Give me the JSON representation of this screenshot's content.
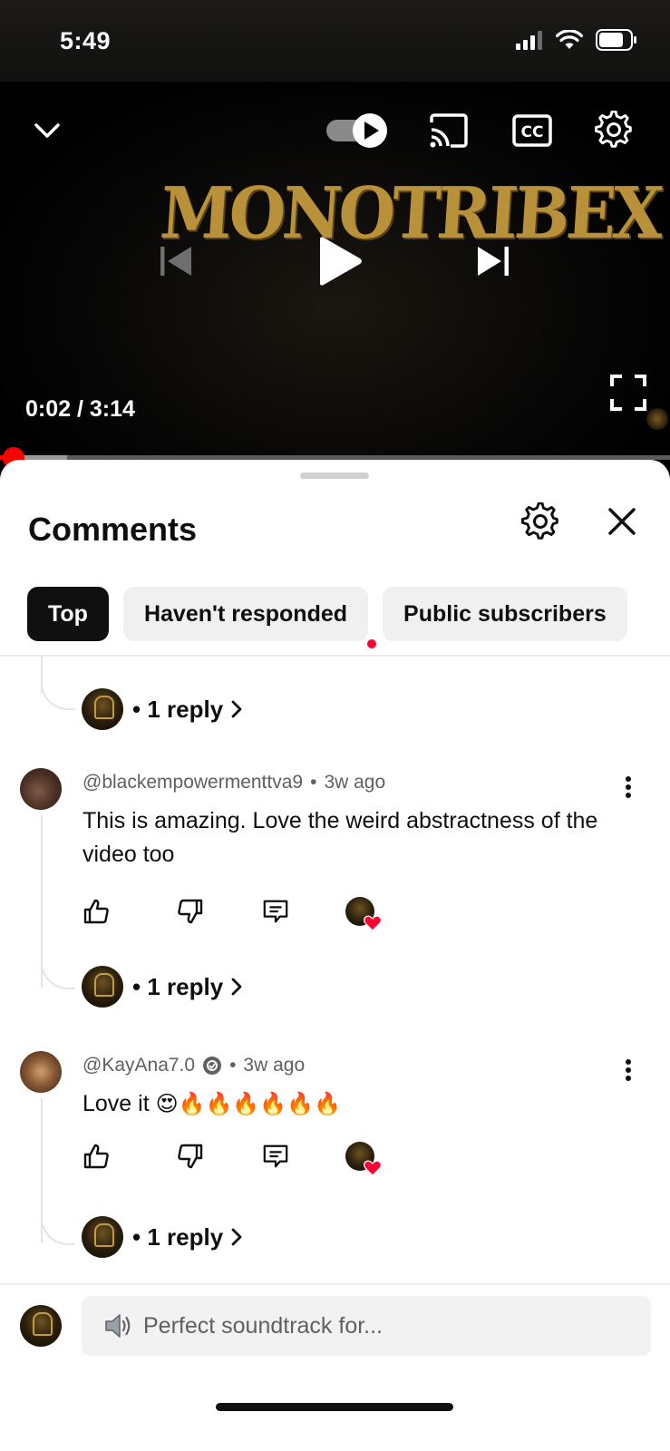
{
  "status_bar": {
    "time": "5:49"
  },
  "player": {
    "video_title_art": "MONOTRIBEX",
    "time": "0:02 / 3:14",
    "progress_fraction": 0.006,
    "buffer_fraction": 0.1,
    "autoplay": true
  },
  "comments_sheet": {
    "title": "Comments",
    "chips": [
      {
        "label": "Top",
        "active": true
      },
      {
        "label": "Haven't responded",
        "active": false
      },
      {
        "label": "Public subscribers",
        "active": false
      }
    ],
    "first_reply": {
      "label": "• 1 reply"
    },
    "comments": [
      {
        "author": "@blackempowermenttva9",
        "time": "3w ago",
        "text": "This is amazing. Love the weird abstractness of the video too",
        "replies": "• 1 reply"
      },
      {
        "author": "@KayAna7.0",
        "time": "3w ago",
        "text": "Love it",
        "emoji": "😍🔥🔥🔥🔥🔥🔥",
        "verified": true,
        "replies": "• 1 reply"
      }
    ],
    "input_placeholder": "Perfect soundtrack for...",
    "input_icon": "speaker-emoji"
  },
  "colors": {
    "accent": "#ff0000",
    "heart": "#ff0033"
  }
}
